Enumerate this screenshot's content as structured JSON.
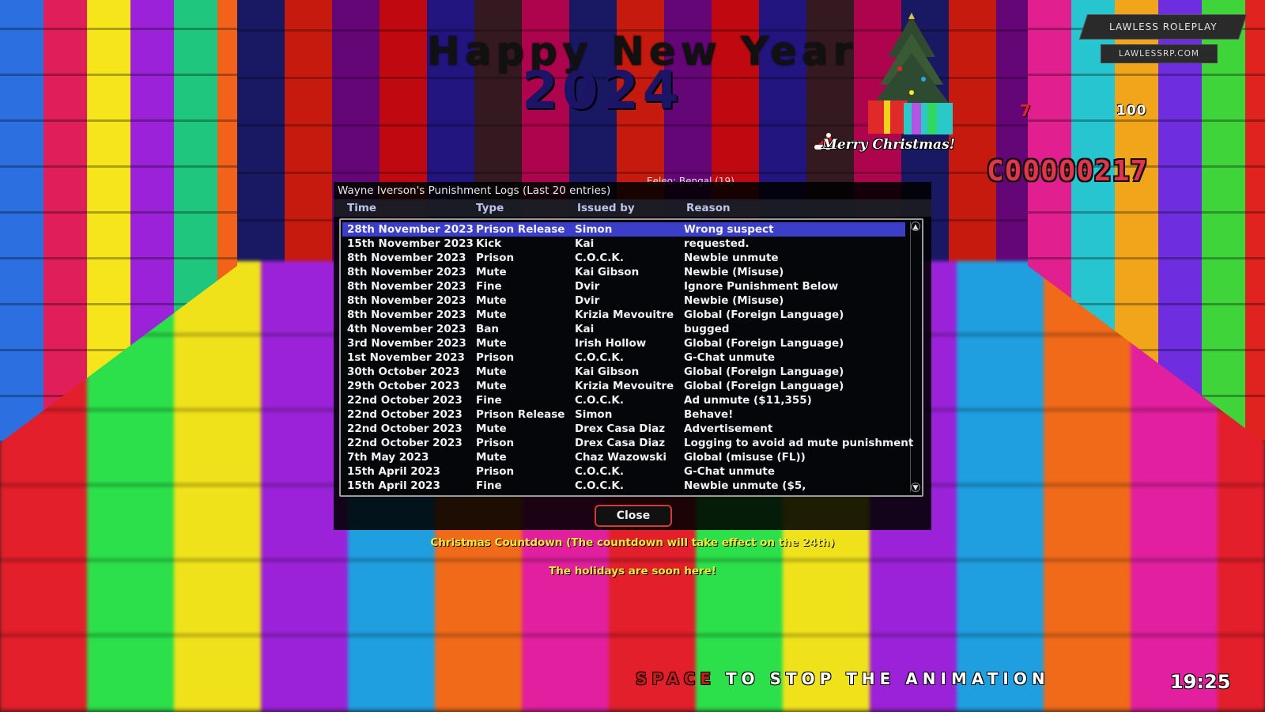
{
  "hud": {
    "title_line1": "Happy New Year",
    "title_line2": "2024",
    "merry_christmas": "Merry Christmas!",
    "server_name": "LAWLESS ROLEPLAY",
    "server_url": "LAWLESSRP.COM",
    "wanted_level": "7",
    "health": "100",
    "money": "C00000217",
    "behind_label": "Eeleo: Bengal (19)",
    "clock": "19:25",
    "space_key": "SPACE",
    "space_rest": "TO STOP THE ANIMATION"
  },
  "dialog": {
    "title": "Wayne Iverson's Punishment Logs (Last 20 entries)",
    "columns": [
      "Time",
      "Type",
      "Issued by",
      "Reason"
    ],
    "selected_index": 0,
    "rows": [
      [
        "28th November 2023",
        "Prison Release",
        "Simon",
        "Wrong suspect"
      ],
      [
        "15th November 2023",
        "Kick",
        "Kai",
        "requested."
      ],
      [
        "8th November 2023",
        "Prison",
        "C.O.C.K.",
        "Newbie unmute"
      ],
      [
        "8th November 2023",
        "Mute",
        "Kai Gibson",
        "Newbie (Misuse)"
      ],
      [
        "8th November 2023",
        "Fine",
        "Dvir",
        "Ignore Punishment Below"
      ],
      [
        "8th November 2023",
        "Mute",
        "Dvir",
        "Newbie (Misuse)"
      ],
      [
        "8th November 2023",
        "Mute",
        "Krizia Mevouitre",
        "Global (Foreign Language)"
      ],
      [
        "4th November 2023",
        "Ban",
        "Kai",
        "bugged"
      ],
      [
        "3rd November 2023",
        "Mute",
        "Irish Hollow",
        "Global (Foreign Language)"
      ],
      [
        "1st November 2023",
        "Prison",
        "C.O.C.K.",
        "G-Chat unmute"
      ],
      [
        "30th October 2023",
        "Mute",
        "Kai Gibson",
        "Global (Foreign Language)"
      ],
      [
        "29th October 2023",
        "Mute",
        "Krizia Mevouitre",
        "Global (Foreign Language)"
      ],
      [
        "22nd October 2023",
        "Fine",
        "C.O.C.K.",
        "Ad unmute ($11,355)"
      ],
      [
        "22nd October 2023",
        "Prison Release",
        "Simon",
        "Behave!"
      ],
      [
        "22nd October 2023",
        "Mute",
        "Drex Casa Diaz",
        "Advertisement"
      ],
      [
        "22nd October 2023",
        "Prison",
        "Drex Casa Diaz",
        "Logging to avoid ad mute punishment"
      ],
      [
        "7th May 2023",
        "Mute",
        "Chaz Wazowski",
        "Global (misuse (FL))"
      ],
      [
        "15th April 2023",
        "Prison",
        "C.O.C.K.",
        "G-Chat unmute"
      ],
      [
        "15th April 2023",
        "Fine",
        "C.O.C.K.",
        "Newbie unmute ($5,"
      ]
    ],
    "close_label": "Close"
  },
  "messages": {
    "countdown": "Christmas Countdown (The countdown will take effect on the 24th)",
    "holidays": "The holidays are soon here!"
  },
  "colors": {
    "selected_row": "#3a3ec8",
    "message_yellow": "#f0ea3a",
    "money_red": "#e0354a"
  }
}
